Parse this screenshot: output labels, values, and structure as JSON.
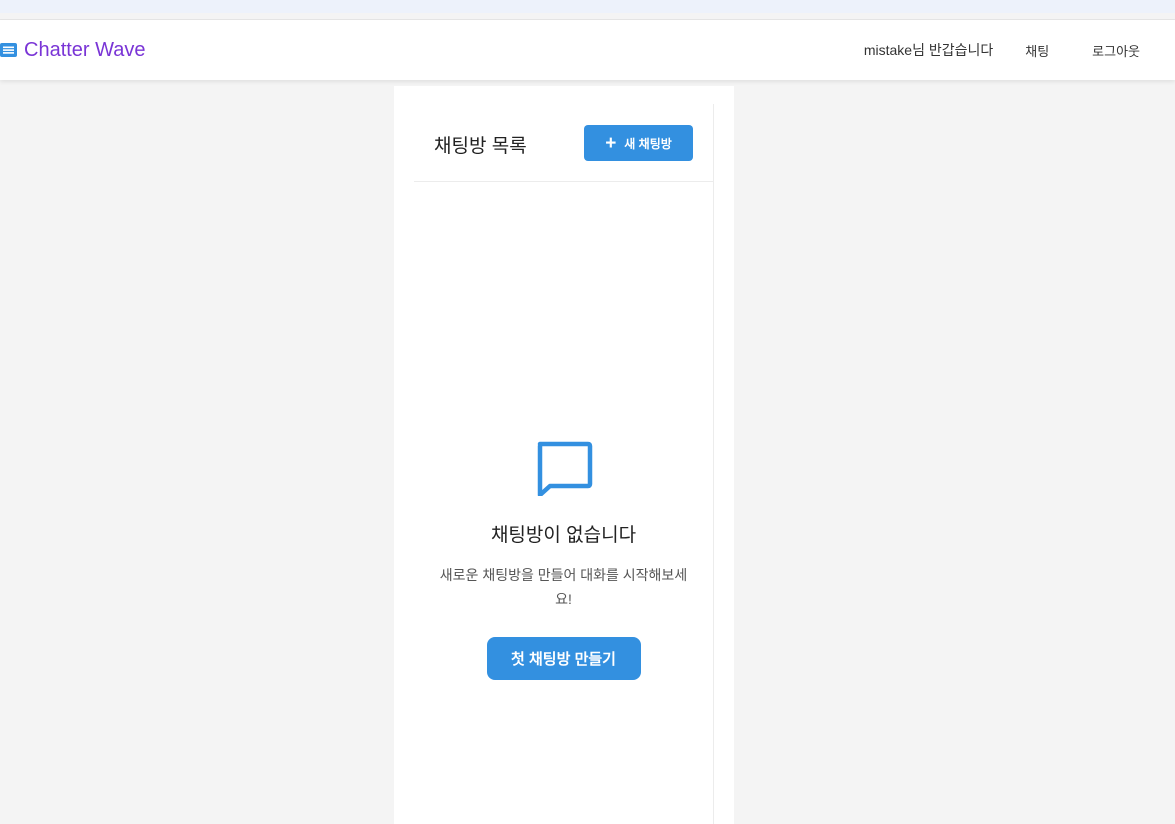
{
  "navbar": {
    "brand_icon": "list-icon",
    "brand_name": "Chatter Wave",
    "brand_color": "#7a35d6",
    "greeting": "mistake님 반갑습니다",
    "links": {
      "chat": "채팅",
      "logout": "로그아웃"
    }
  },
  "room_list": {
    "title": "채팅방 목록",
    "new_room_button": {
      "icon": "plus-icon",
      "label": "새 채팅방"
    },
    "empty_state": {
      "icon": "chat-bubble-icon",
      "title": "채팅방이 없습니다",
      "description": "새로운 채팅방을 만들어 대화를 시작해보세요!",
      "button_label": "첫 채팅방 만들기"
    }
  },
  "colors": {
    "accent": "#3390e0",
    "brand": "#7a35d6",
    "page_background": "#f4f4f4"
  }
}
